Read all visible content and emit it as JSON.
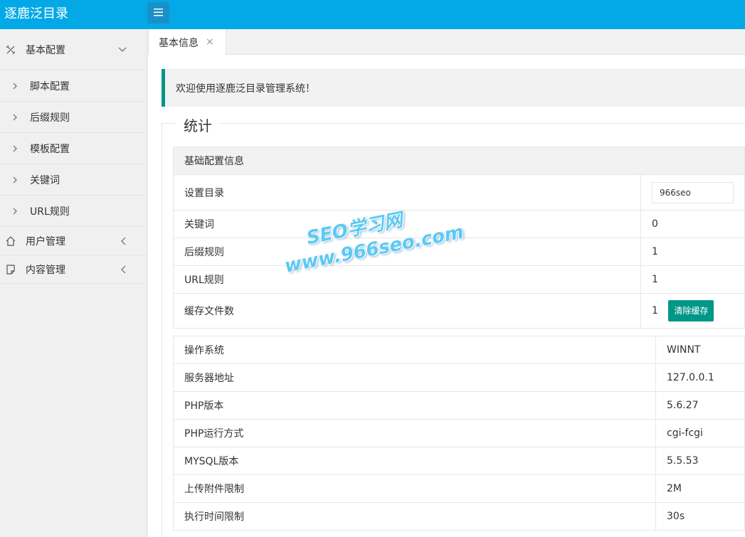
{
  "header": {
    "logo": "逐鹿泛目录",
    "menu_icon": "hamburger-icon",
    "bg_color": "#03a9e6"
  },
  "sidebar": {
    "groups": [
      {
        "label": "基本配置",
        "icon": "tools-icon",
        "arrow": "chevron-down-icon"
      },
      {
        "label": "用户管理",
        "icon": "home-icon",
        "arrow": "chevron-left-icon"
      },
      {
        "label": "内容管理",
        "icon": "document-icon",
        "arrow": "chevron-left-icon"
      }
    ],
    "sub_items": [
      {
        "label": "脚本配置"
      },
      {
        "label": "后缀规则"
      },
      {
        "label": "模板配置"
      },
      {
        "label": "关键词"
      },
      {
        "label": "URL规则"
      }
    ]
  },
  "tabs": [
    {
      "label": "基本信息",
      "close": "×"
    }
  ],
  "welcome": {
    "text": "欢迎使用逐鹿泛目录管理系统！"
  },
  "stats": {
    "legend": "统计",
    "config_header": "基础配置信息",
    "config_rows": [
      {
        "label": "设置目录",
        "value": "966seo"
      },
      {
        "label": "关键词",
        "value": "0"
      },
      {
        "label": "后缀规则",
        "value": "1"
      },
      {
        "label": "URL规则",
        "value": "1"
      },
      {
        "label": "缓存文件数",
        "value": "1",
        "button": "清除缓存"
      }
    ],
    "system_rows": [
      {
        "label": "操作系统",
        "value": "WINNT"
      },
      {
        "label": "服务器地址",
        "value": "127.0.0.1"
      },
      {
        "label": "PHP版本",
        "value": "5.6.27"
      },
      {
        "label": "PHP运行方式",
        "value": "cgi-fcgi"
      },
      {
        "label": "MYSQL版本",
        "value": "5.5.53"
      },
      {
        "label": "上传附件限制",
        "value": "2M"
      },
      {
        "label": "执行时间限制",
        "value": "30s"
      }
    ]
  },
  "watermark": {
    "line1": "SEO学习网",
    "line2": "www.966seo.com"
  },
  "colors": {
    "accent": "#009688",
    "header": "#03a9e6"
  }
}
